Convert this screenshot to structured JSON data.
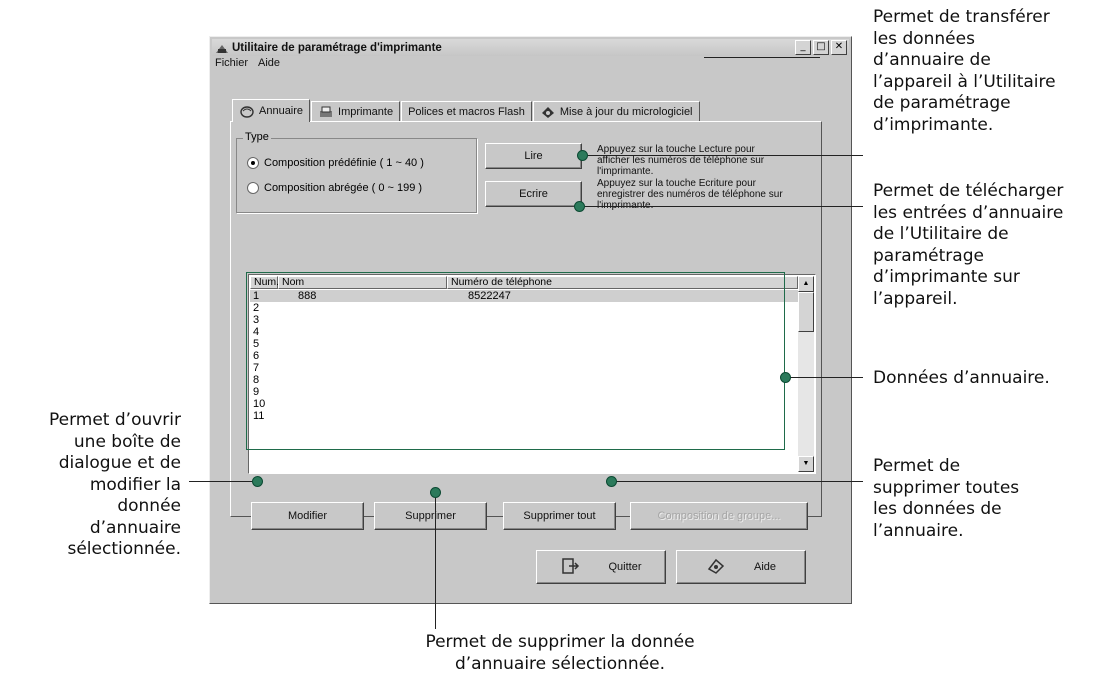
{
  "window": {
    "title": "Utilitaire de paramétrage d'imprimante",
    "menu": [
      "Fichier",
      "Aide"
    ],
    "controls": [
      "_",
      "□",
      "✕"
    ]
  },
  "tabs": [
    {
      "label": "Annuaire",
      "icon": "phonebook-icon"
    },
    {
      "label": "Imprimante",
      "icon": "printer-icon"
    },
    {
      "label": "Polices et macros Flash",
      "icon": ""
    },
    {
      "label": "Mise à jour du micrologiciel",
      "icon": "firmware-icon"
    }
  ],
  "type_group": {
    "legend": "Type",
    "options": [
      {
        "label": "Composition prédéfinie ( 1 ~ 40 )",
        "selected": true
      },
      {
        "label": "Composition abrégée ( 0 ~ 199 )",
        "selected": false
      }
    ]
  },
  "read_button": "Lire",
  "read_desc": [
    "Appuyez sur la touche Lecture pour",
    "afficher les numéros de téléphone sur",
    "l'imprimante."
  ],
  "write_button": "Ecrire",
  "write_desc": [
    "Appuyez sur la touche Ecriture pour",
    "enregistrer des numéros de téléphone sur",
    "l'imprimante."
  ],
  "table": {
    "headers": [
      "Num.",
      "Nom",
      "Numéro de téléphone"
    ],
    "rows": [
      [
        "1",
        "888",
        "8522247"
      ],
      [
        "2",
        "",
        ""
      ],
      [
        "3",
        "",
        ""
      ],
      [
        "4",
        "",
        ""
      ],
      [
        "5",
        "",
        ""
      ],
      [
        "6",
        "",
        ""
      ],
      [
        "7",
        "",
        ""
      ],
      [
        "8",
        "",
        ""
      ],
      [
        "9",
        "",
        ""
      ],
      [
        "10",
        "",
        ""
      ],
      [
        "11",
        "",
        ""
      ]
    ]
  },
  "action_buttons": {
    "edit": "Modifier",
    "delete": "Supprimer",
    "delete_all": "Supprimer tout",
    "group_dial": "Composition de groupe..."
  },
  "bottom_buttons": {
    "quit": "Quitter",
    "help": "Aide"
  },
  "annotations": {
    "read": [
      "Permet de transférer",
      "les données",
      "d’annuaire de",
      "l’appareil à l’Utilitaire",
      "de paramétrage",
      "d’imprimante."
    ],
    "write": [
      "Permet de télécharger",
      "les entrées d’annuaire",
      "de l’Utilitaire de",
      "paramétrage",
      "d’imprimante sur",
      "l’appareil."
    ],
    "data": [
      "Données d’annuaire."
    ],
    "delete_all": [
      "Permet de",
      "supprimer toutes",
      "les données de",
      "l’annuaire."
    ],
    "edit": [
      "Permet d’ouvrir",
      "une boîte de",
      "dialogue et de",
      "modifier la",
      "donnée",
      "d’annuaire",
      "sélectionnée."
    ],
    "delete": [
      "Permet de supprimer la donnée",
      "d’annuaire sélectionnée."
    ]
  }
}
